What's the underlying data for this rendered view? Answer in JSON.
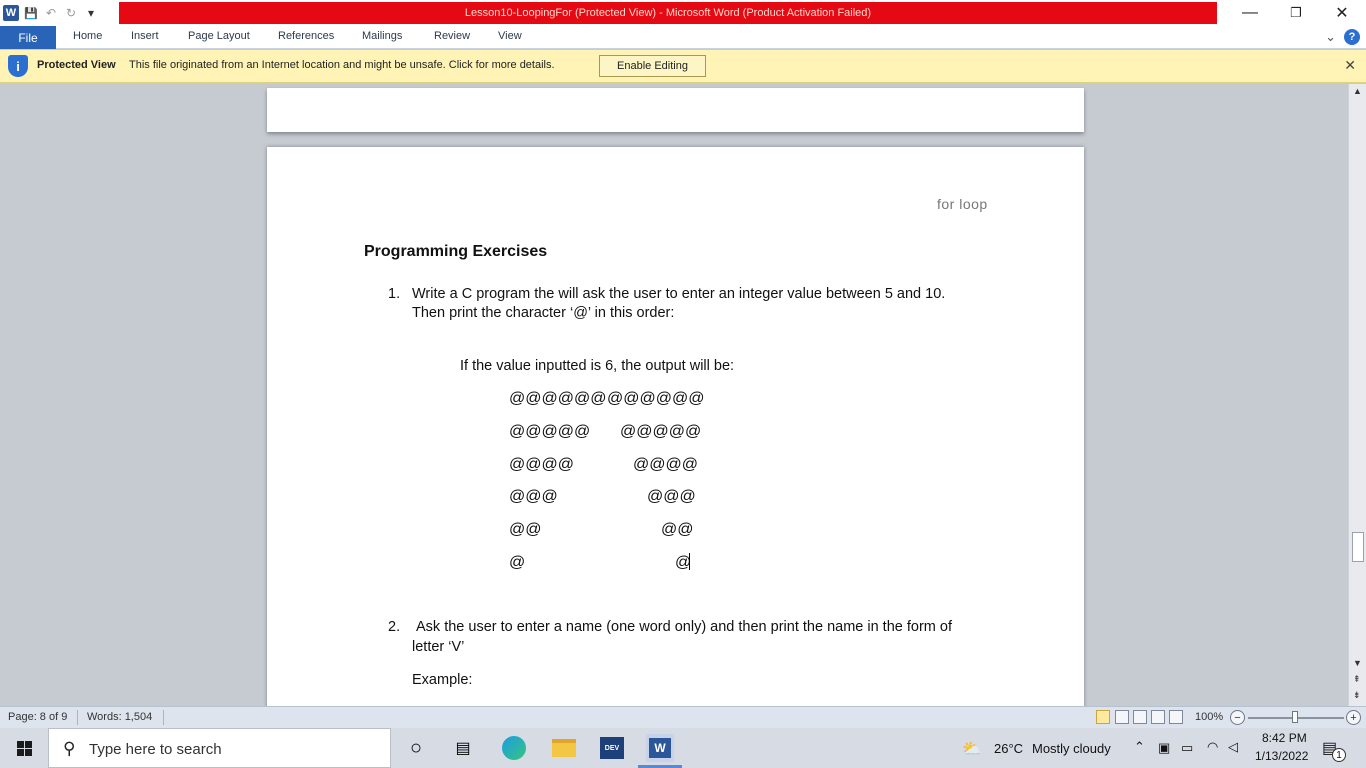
{
  "titlebar": {
    "title": "Lesson10-LoopingFor (Protected View)  -  Microsoft Word (Product Activation Failed)",
    "minimize": "—",
    "restore": "❐",
    "close": "✕"
  },
  "qat": {
    "logo": "W",
    "save": "💾",
    "undo": "↶",
    "redo": "↻",
    "customize": "▾"
  },
  "ribbon": {
    "file_tab": "File",
    "tabs": [
      "Home",
      "Insert",
      "Page Layout",
      "References",
      "Mailings",
      "Review",
      "View"
    ],
    "collapse_icon": "⌄",
    "help": "?"
  },
  "protected_view": {
    "label": "Protected View",
    "message": "This file originated from an Internet location and might be unsafe. Click for more details.",
    "button": "Enable Editing",
    "close": "✕",
    "shield": "i"
  },
  "document": {
    "header": "for loop",
    "heading": "Programming Exercises",
    "item1_num": "1.",
    "item1_line1": "Write a C program the will ask the user to enter an integer value between 5 and 10.",
    "item1_line2": "Then print the character ‘@’ in this order:",
    "example_intro": "If the value inputted is 6, the output will be:",
    "pattern_left": [
      "@@@@@@",
      "@@@@@",
      "@@@@",
      "@@@",
      "@@",
      "@"
    ],
    "pattern_right": [
      "@@@@@@",
      "@@@@@",
      "@@@@",
      "@@@",
      "@@",
      "@"
    ],
    "item2_num": "2.",
    "item2_line1": "Ask the user to enter a name (one word only) and then print the name in the form of",
    "item2_line2": "letter ‘V’",
    "example_label": "Example:"
  },
  "statusbar": {
    "page": "Page: 8 of 9",
    "words": "Words: 1,504",
    "zoom": "100%",
    "zoom_minus": "−",
    "zoom_plus": "+"
  },
  "taskbar": {
    "search_placeholder": "Type here to search",
    "weather_temp": "26°C",
    "weather_desc": "Mostly cloudy",
    "time": "8:42 PM",
    "date": "1/13/2022",
    "notification_count": "1"
  }
}
